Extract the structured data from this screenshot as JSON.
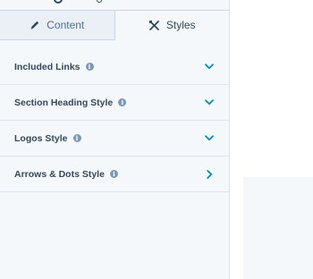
{
  "tabs": [
    {
      "label": "Content",
      "icon": "pencil-icon",
      "active": false
    },
    {
      "label": "Styles",
      "icon": "brush-ruler-icon",
      "active": true
    }
  ],
  "sections": [
    {
      "label": "Included Links",
      "expand": "chevron-down"
    },
    {
      "label": "Section Heading Style",
      "expand": "chevron-down"
    },
    {
      "label": "Logos Style",
      "expand": "chevron-down"
    },
    {
      "label": "Arrows & Dots Style",
      "expand": "chevron-right"
    }
  ],
  "info_glyph": "i",
  "colors": {
    "panel_bg": "#f5f8fa",
    "tab_inactive_bg": "#eaf0f6",
    "text": "#33475b",
    "accent_chevron": "#0091ae",
    "info_icon": "#7c98b6",
    "border": "#dfe3eb"
  }
}
